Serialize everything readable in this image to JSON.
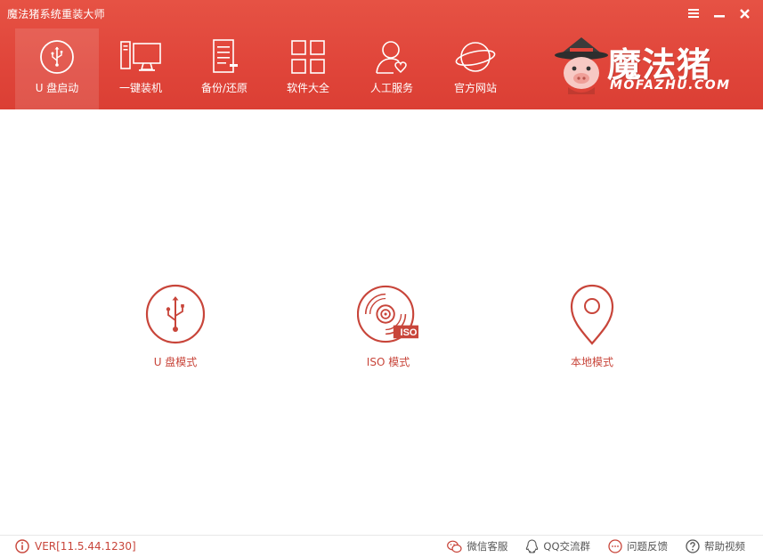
{
  "window": {
    "title": "魔法猪系统重装大师",
    "controls": [
      "menu",
      "minimize",
      "close"
    ]
  },
  "nav": {
    "items": [
      {
        "label": "U 盘启动",
        "icon": "usb-icon",
        "active": true
      },
      {
        "label": "一键装机",
        "icon": "computer-icon",
        "active": false
      },
      {
        "label": "备份/还原",
        "icon": "document-icon",
        "active": false
      },
      {
        "label": "软件大全",
        "icon": "grid-icon",
        "active": false
      },
      {
        "label": "人工服务",
        "icon": "person-icon",
        "active": false
      },
      {
        "label": "官方网站",
        "icon": "globe-icon",
        "active": false
      }
    ]
  },
  "brand": {
    "name_cn": "魔法猪",
    "name_en": "MOFAZHU.COM"
  },
  "modes": [
    {
      "label": "U 盘模式",
      "icon": "usb-circle-icon"
    },
    {
      "label": "ISO 模式",
      "icon": "iso-disc-icon",
      "badge": "ISO"
    },
    {
      "label": "本地模式",
      "icon": "location-pin-icon"
    }
  ],
  "footer": {
    "version": "VER[11.5.44.1230]",
    "links": [
      {
        "label": "微信客服",
        "icon": "wechat-icon"
      },
      {
        "label": "QQ交流群",
        "icon": "qq-icon"
      },
      {
        "label": "问题反馈",
        "icon": "feedback-icon"
      },
      {
        "label": "帮助视频",
        "icon": "help-icon"
      }
    ]
  },
  "colors": {
    "header": "#e0453a",
    "accent": "#c8453a",
    "footer_text": "#555555"
  }
}
